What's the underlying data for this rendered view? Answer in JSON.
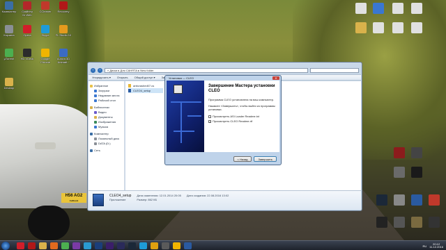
{
  "desktop_icons_left": [
    {
      "label": "Компьютер",
      "color": "#3a6ea5",
      "icon": "computer-icon"
    },
    {
      "label": "Скайнер Dr.Web",
      "color": "#b3262a",
      "icon": "drweb-icon"
    },
    {
      "label": "CCleaner",
      "color": "#c0392b",
      "icon": "ccleaner-icon"
    },
    {
      "label": "Recovery",
      "color": "#b01818",
      "icon": "recovery-icon"
    },
    {
      "label": "Корзина",
      "color": "#8a8f96",
      "icon": "recycle-bin-icon"
    },
    {
      "label": "Opera",
      "color": "#d11e2a",
      "icon": "opera-icon"
    },
    {
      "label": "Skype",
      "color": "#1e9bd7",
      "icon": "skype-icon"
    },
    {
      "label": "FL Studio 10",
      "color": "#e49a1d",
      "icon": "fl-studio-icon"
    },
    {
      "label": "µTorrent",
      "color": "#4caf50",
      "icon": "utorrent-icon"
    },
    {
      "label": "HD VDeck",
      "color": "#2c2c2c",
      "icon": "hdvdeck-icon"
    },
    {
      "label": "Google Chrome",
      "color": "#f0b400",
      "icon": "chrome-icon"
    },
    {
      "label": "Aurora 3D Animati...",
      "color": "#3b6bc4",
      "icon": "aurora-icon"
    },
    {
      "label": "Desktop",
      "color": "#d9b24b",
      "icon": "folder-icon"
    }
  ],
  "desktop_icons_right": [
    {
      "label": "",
      "color": "#e0e0e0",
      "icon": "document-icon"
    },
    {
      "label": "",
      "color": "#3a77d1",
      "icon": "audio-icon"
    },
    {
      "label": "",
      "color": "#e0e0e0",
      "icon": "document-icon"
    },
    {
      "label": "",
      "color": "#e0e0e0",
      "icon": "document-icon"
    },
    {
      "label": "",
      "color": "#d9b24b",
      "icon": "folder-icon"
    },
    {
      "label": "",
      "color": "#e0e0e0",
      "icon": "document-icon"
    },
    {
      "label": "",
      "color": "#e0e0e0",
      "icon": "document-icon"
    },
    {
      "label": "",
      "color": "#e0e0e0",
      "icon": "document-icon"
    },
    {
      "label": "",
      "color": "#8c1c1c",
      "icon": "game-icon"
    },
    {
      "label": "",
      "color": "#444444",
      "icon": "game-icon"
    },
    {
      "label": "",
      "color": "#6a6a6a",
      "icon": "game-icon"
    },
    {
      "label": "",
      "color": "#1a1a1a",
      "icon": "game-icon"
    },
    {
      "label": "",
      "color": "#1b2838",
      "icon": "steam-icon"
    },
    {
      "label": "",
      "color": "#888888",
      "icon": "game-icon"
    },
    {
      "label": "",
      "color": "#2a5aa0",
      "icon": "game-icon"
    },
    {
      "label": "",
      "color": "#c0392b",
      "icon": "game-icon"
    },
    {
      "label": "",
      "color": "#222222",
      "icon": "game-icon"
    },
    {
      "label": "",
      "color": "#555555",
      "icon": "game-icon"
    },
    {
      "label": "",
      "color": "#7a6a40",
      "icon": "game-icon"
    },
    {
      "label": "",
      "color": "#333333",
      "icon": "game-icon"
    }
  ],
  "explorer": {
    "address": "« Диски  ▸  Для САНЯТА  ▸  New folder",
    "toolbar": [
      "Упорядочить ▾",
      "Открыть",
      "Общий доступ ▾",
      "Записать на оптический диск",
      "Новая папка"
    ],
    "nav": [
      {
        "label": "Избранное",
        "level": 1,
        "color": "#e8c24a"
      },
      {
        "label": "Загрузки",
        "level": 2,
        "color": "#3a77d1"
      },
      {
        "label": "Недавние места",
        "level": 2,
        "color": "#3a77d1"
      },
      {
        "label": "Рабочий стол",
        "level": 2,
        "color": "#3a77d1"
      },
      {
        "label": "",
        "level": 1,
        "color": "#ffffff"
      },
      {
        "label": "Библиотеки",
        "level": 1,
        "color": "#d9b24b"
      },
      {
        "label": "Видео",
        "level": 2,
        "color": "#6a5acd"
      },
      {
        "label": "Документы",
        "level": 2,
        "color": "#d9b24b"
      },
      {
        "label": "Изображения",
        "level": 2,
        "color": "#3a8a5a"
      },
      {
        "label": "Музыка",
        "level": 2,
        "color": "#3a77d1"
      },
      {
        "label": "",
        "level": 1,
        "color": "#ffffff"
      },
      {
        "label": "Компьютер",
        "level": 1,
        "color": "#3a6ea5"
      },
      {
        "label": "Локальный диск",
        "level": 2,
        "color": "#8a8f96"
      },
      {
        "label": "DATA (D:)",
        "level": 2,
        "color": "#8a8f96"
      },
      {
        "label": "",
        "level": 1,
        "color": "#ffffff"
      },
      {
        "label": "Сеть",
        "level": 1,
        "color": "#3a6ea5"
      }
    ],
    "files": [
      {
        "name": "anticrashed07.cs",
        "selected": false
      },
      {
        "name": "CLEO4_setup",
        "selected": true
      }
    ],
    "details": {
      "name": "CLEO4_setup",
      "type": "Приложение",
      "modified_label": "Дата изменения: 12.01.2014 20:05",
      "size_label": "Размер: 862 КБ",
      "created_label": "Дата создания: 22.08.2016 13:02"
    }
  },
  "installer": {
    "title": "Установка — CLEO",
    "heading": "Завершение Мастера установки CLEO",
    "text1": "Программа CLEO установлена на ваш компьютер.",
    "text2": "Нажмите «Завершить», чтобы выйти из программы установки.",
    "checkbox1_label": "Просмотреть ASI Loader Readme.txt",
    "checkbox1_checked": false,
    "checkbox2_label": "Просмотреть CLEO Readme.rtf",
    "checkbox2_checked": true,
    "back_label": "< Назад",
    "finish_label": "Завершить",
    "close_label": "✕"
  },
  "taskbar": {
    "apps": [
      {
        "icon": "opera-icon",
        "color": "#d11e2a"
      },
      {
        "icon": "recovery-icon",
        "color": "#b01818"
      },
      {
        "icon": "folder-icon",
        "color": "#d9b24b"
      },
      {
        "icon": "media-player-icon",
        "color": "#e26a1e"
      },
      {
        "icon": "utorrent-icon",
        "color": "#4caf50"
      },
      {
        "icon": "app-icon",
        "color": "#7a3aa5"
      },
      {
        "icon": "app-icon",
        "color": "#2a9ad1"
      },
      {
        "icon": "photoshop-icon",
        "color": "#1b3e7a"
      },
      {
        "icon": "after-effects-icon",
        "color": "#3b1e6a"
      },
      {
        "icon": "app-icon",
        "color": "#2a2a5a"
      },
      {
        "icon": "steam-icon",
        "color": "#1b2838"
      },
      {
        "icon": "skype-icon",
        "color": "#1e9bd7"
      },
      {
        "icon": "app-icon",
        "color": "#e0a010"
      },
      {
        "icon": "app-icon",
        "color": "#5a5a5a"
      },
      {
        "icon": "chrome-icon",
        "color": "#f0b400"
      },
      {
        "icon": "installer-icon",
        "color": "#2a5aa0"
      }
    ],
    "language": "RU",
    "time": "20:12",
    "date": "11.12.2016"
  }
}
